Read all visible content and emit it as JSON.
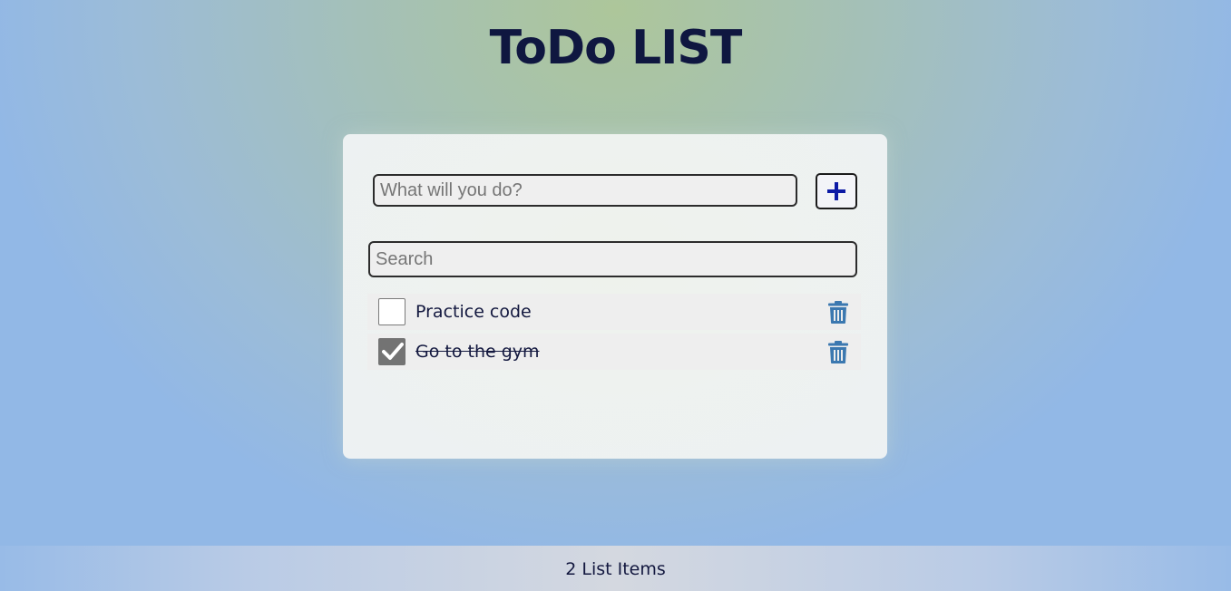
{
  "header": {
    "title": "ToDo LIST"
  },
  "add_form": {
    "placeholder": "What will you do?",
    "value": ""
  },
  "search": {
    "placeholder": "Search",
    "value": ""
  },
  "items": [
    {
      "label": "Practice code",
      "checked": false
    },
    {
      "label": "Go to the gym",
      "checked": true
    }
  ],
  "footer": {
    "count_text": "2 List Items"
  },
  "colors": {
    "title": "#0f1740",
    "plus_icon": "#0c1aa5",
    "trash_icon": "#3b78b0",
    "checkbox_checked": "#737373"
  },
  "icons": {
    "add": "plus-icon",
    "delete": "trash-icon",
    "checked": "checkmark-icon"
  }
}
